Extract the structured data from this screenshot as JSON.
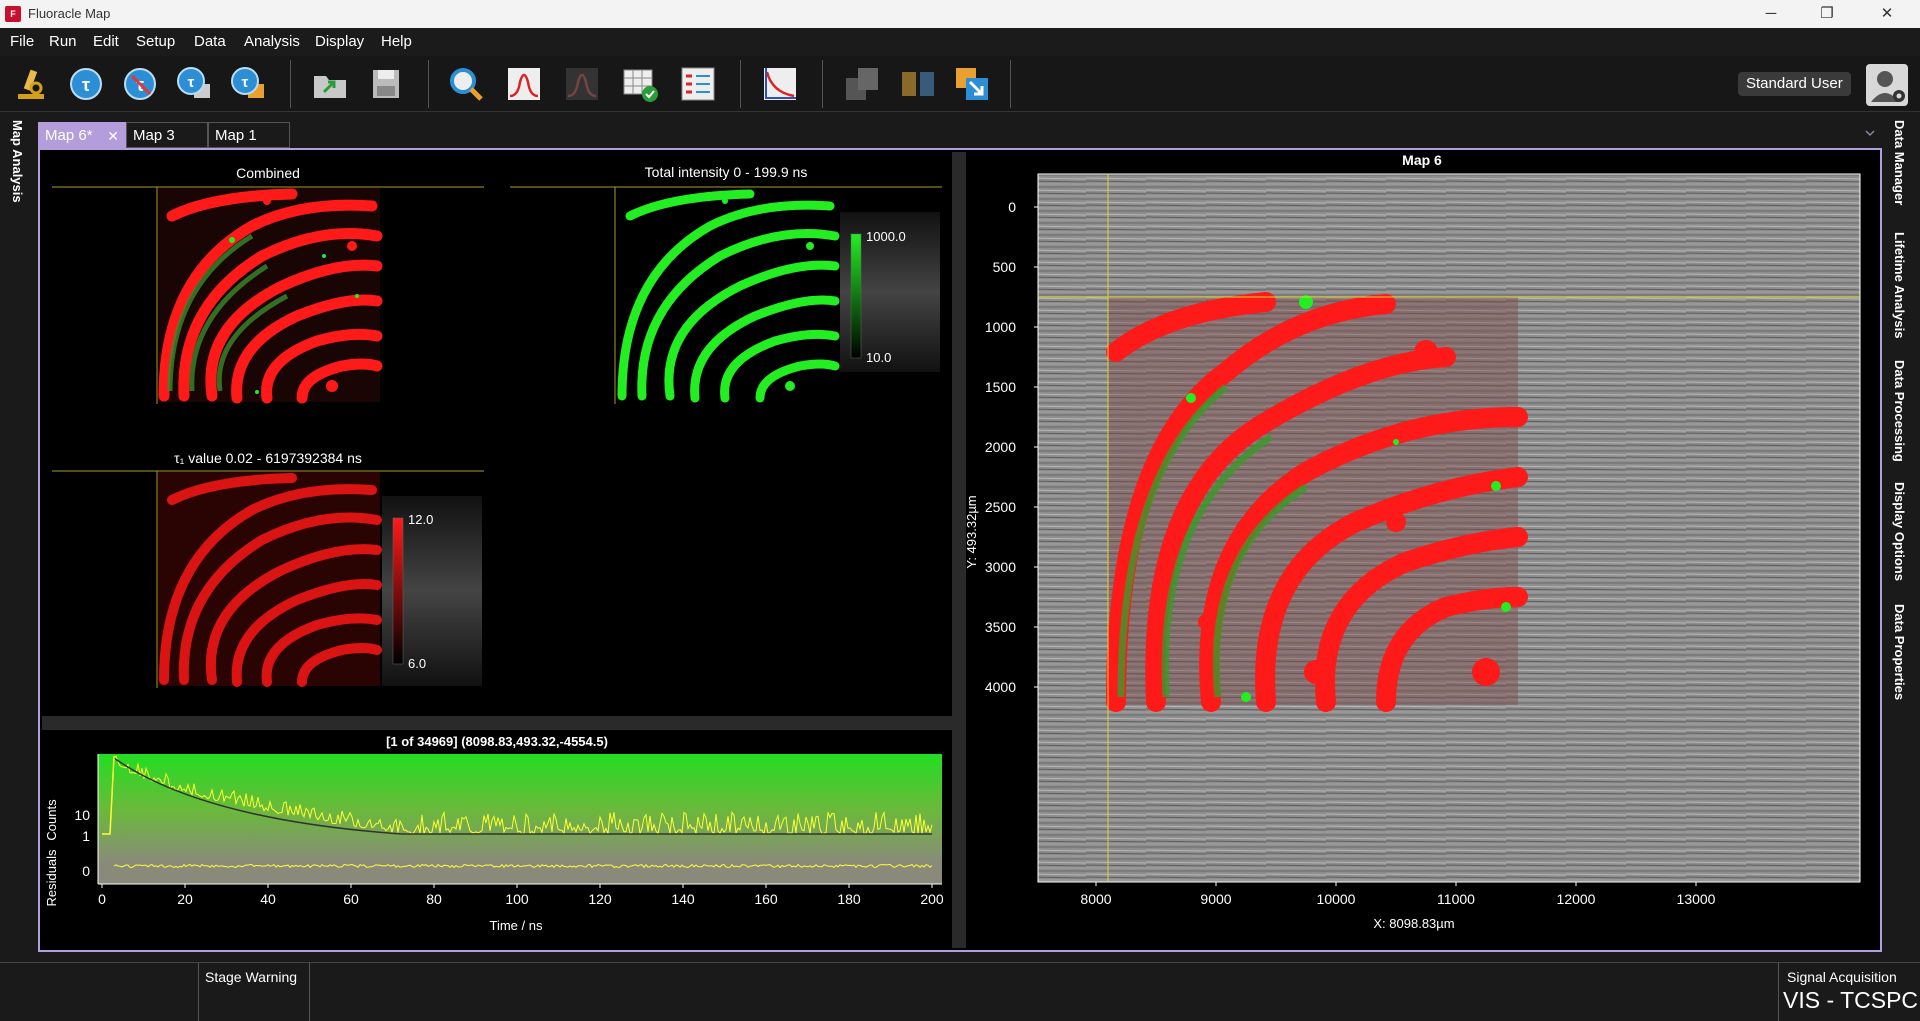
{
  "window": {
    "title": "Fluoracle Map",
    "icon_letter": "F",
    "minimize": "─",
    "restore": "❐",
    "close": "✕"
  },
  "menu": [
    "File",
    "Run",
    "Edit",
    "Setup",
    "Data",
    "Analysis",
    "Display",
    "Help"
  ],
  "user": {
    "label": "Standard User"
  },
  "left_sidebar": {
    "label": "Map Analysis"
  },
  "right_sidebar": [
    "Data Manager",
    "Lifetime Analysis",
    "Data Processing",
    "Display Options",
    "Data Properties"
  ],
  "tabs": [
    {
      "label": "Map 6*",
      "active": true
    },
    {
      "label": "Map 3",
      "active": false
    },
    {
      "label": "Map 1",
      "active": false
    }
  ],
  "panels": {
    "combined": {
      "title": "Combined"
    },
    "intensity": {
      "title": "Total intensity  0 - 199.9 ns",
      "scale_max": "1000.0",
      "scale_min": "10.0"
    },
    "tau": {
      "title": "τ₁ value  0.02 - 6197392384 ns",
      "scale_max": "12.0",
      "scale_min": "6.0"
    }
  },
  "decay": {
    "title": "[1 of 34969] (8098.83,493.32,-4554.5)",
    "ylabel_counts": "Counts",
    "ylabel_residuals": "Residuals",
    "xlabel": "Time / ns",
    "counts_ticks": [
      "10",
      "1"
    ],
    "residual_ticks": [
      "0"
    ],
    "xticks": [
      "0",
      "20",
      "40",
      "60",
      "80",
      "100",
      "120",
      "140",
      "160",
      "180",
      "200"
    ]
  },
  "map": {
    "title": "Map 6",
    "ylabel": "Y: 493.32µm",
    "xlabel": "X: 8098.83µm",
    "yticks": [
      "0",
      "500",
      "1000",
      "1500",
      "2000",
      "2500",
      "3000",
      "3500",
      "4000"
    ],
    "xticks": [
      "8000",
      "9000",
      "10000",
      "11000",
      "12000",
      "13000"
    ]
  },
  "status": {
    "warning": "Stage Warning",
    "signal_label": "Signal Acquisition",
    "signal_value": "VIS - TCSPC"
  },
  "colors": {
    "accent": "#b39ddb",
    "red": "#ff1a1a",
    "green": "#22ee22",
    "yellow": "#ffff33"
  }
}
